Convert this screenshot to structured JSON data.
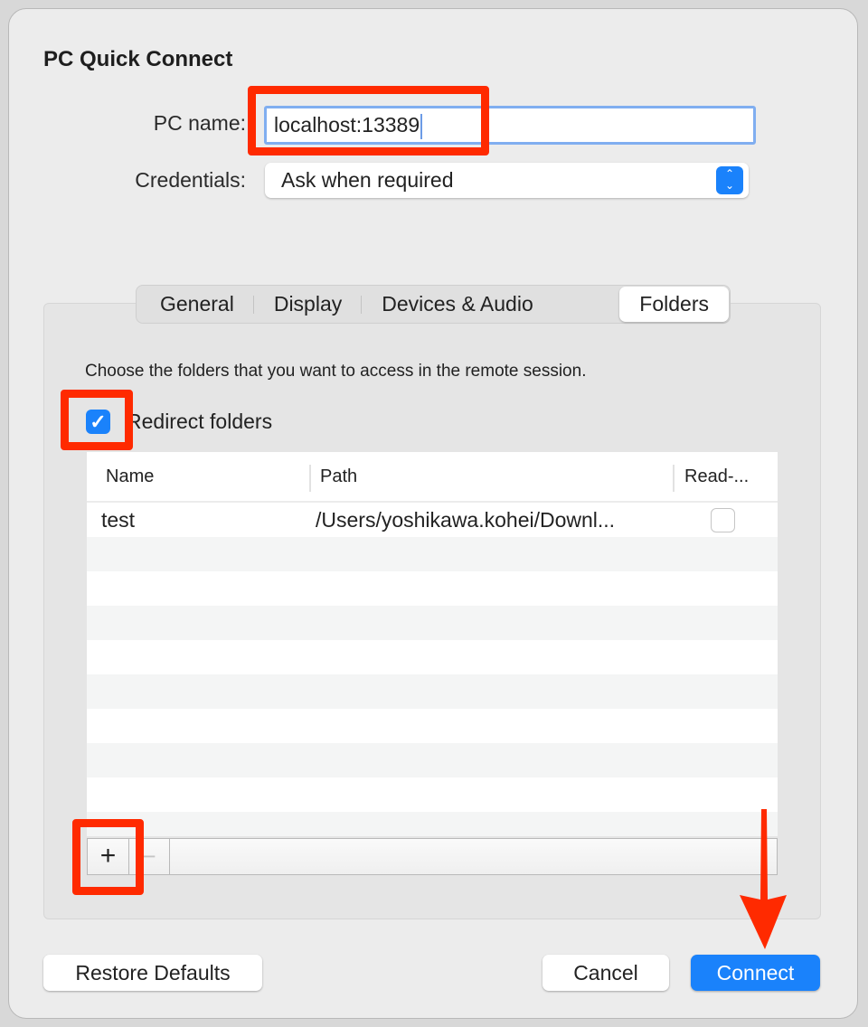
{
  "window": {
    "title": "PC Quick Connect"
  },
  "form": {
    "pc_name_label": "PC name:",
    "pc_name_value": "localhost:13389",
    "credentials_label": "Credentials:",
    "credentials_value": "Ask when required"
  },
  "tabs": [
    {
      "label": "General"
    },
    {
      "label": "Display"
    },
    {
      "label": "Devices & Audio"
    },
    {
      "label": "Folders",
      "selected": true
    }
  ],
  "folders": {
    "description": "Choose the folders that you want to access in the remote session.",
    "redirect_label": "Redirect folders",
    "redirect_checked": true,
    "columns": [
      "Name",
      "Path",
      "Read-..."
    ],
    "rows": [
      {
        "name": "test",
        "path": "/Users/yoshikawa.kohei/Downl...",
        "read_only": false
      }
    ],
    "add_label": "+",
    "remove_label": "−"
  },
  "buttons": {
    "restore": "Restore Defaults",
    "cancel": "Cancel",
    "connect": "Connect"
  },
  "colors": {
    "accent": "#1a82fb",
    "annotation": "#ff2a00"
  }
}
